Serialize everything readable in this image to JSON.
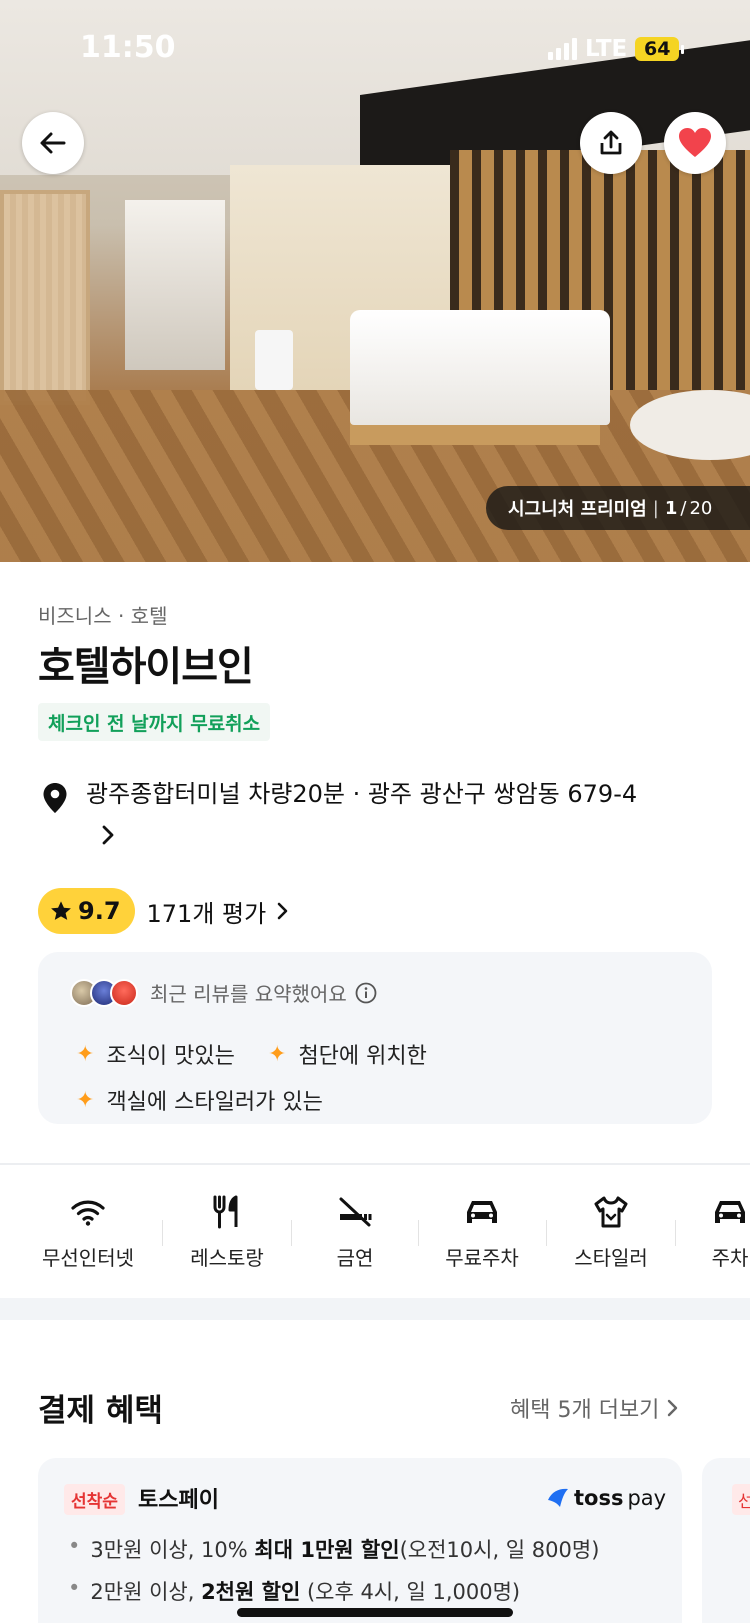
{
  "status_bar": {
    "time": "11:50",
    "network": "LTE",
    "battery": "64"
  },
  "photo": {
    "room_name": "시그니처 프리미엄",
    "index": "1",
    "total": "20"
  },
  "hotel": {
    "category": "비즈니스 · 호텔",
    "name": "호텔하이브인",
    "cancel_badge": "체크인 전 날까지 무료취소",
    "address": "광주종합터미널 차량20분 · 광주 광산구 쌍암동 679-4"
  },
  "rating": {
    "score": "9.7",
    "review_count": "171개 평가"
  },
  "review_summary": {
    "label": "최근 리뷰를 요약했어요",
    "tags": [
      "조식이 맛있는",
      "첨단에 위치한",
      "객실에 스타일러가 있는"
    ]
  },
  "amenities": [
    {
      "icon": "wifi-icon",
      "label": "무선인터넷"
    },
    {
      "icon": "restaurant-icon",
      "label": "레스토랑"
    },
    {
      "icon": "no-smoking-icon",
      "label": "금연"
    },
    {
      "icon": "car-icon",
      "label": "무료주차"
    },
    {
      "icon": "styler-icon",
      "label": "스타일러"
    },
    {
      "icon": "car-icon",
      "label": "주차"
    }
  ],
  "payment": {
    "title": "결제 혜택",
    "more": "혜택 5개 더보기",
    "card": {
      "badge": "선착순",
      "name": "토스페이",
      "logo_brand": "toss",
      "logo_pay": "pay",
      "line1": {
        "pre": "3만원 이상, 10% ",
        "bold": "최대 1만원 할인",
        "post": "(오전10시, 일 800명)"
      },
      "line2": {
        "pre": "2만원 이상, ",
        "bold": "2천원 할인",
        "post": " (오후 4시, 일 1,000명)"
      }
    },
    "peek_badge": "선"
  },
  "colors": {
    "accent_green": "#12a05a",
    "rating_yellow": "#ffd23a",
    "like_red": "#f2434c",
    "spark_orange": "#ff9d1b"
  }
}
